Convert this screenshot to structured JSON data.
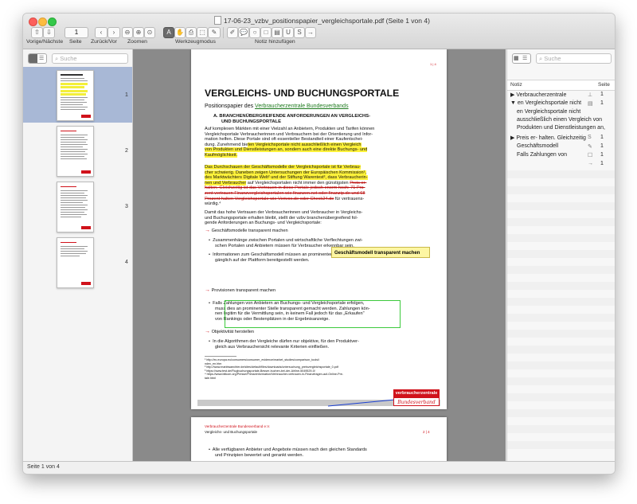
{
  "window": {
    "title": "17-06-23_vzbv_positionspapier_vergleichsportale.pdf (Seite 1 von 4)"
  },
  "toolbar": {
    "page_field_value": "1",
    "labels": {
      "prev_next": "Vorige/Nächste",
      "page": "Seite",
      "back_forward": "Zurück/Vor",
      "zoom": "Zoomen",
      "tool_mode": "Werkzeugmodus",
      "add_note": "Notiz hinzufügen"
    }
  },
  "sidebar": {
    "search_placeholder": "Suche",
    "thumbnails": [
      {
        "page_number": "1",
        "selected": true
      },
      {
        "page_number": "2",
        "selected": false
      },
      {
        "page_number": "3",
        "selected": false
      },
      {
        "page_number": "4",
        "selected": false
      }
    ]
  },
  "document": {
    "page1": {
      "page_marker": "1 | 4",
      "title": "VERGLEICHS- UND BUCHUNGSPORTALE",
      "subtitle_prefix": "Positionspapier des ",
      "subtitle_link": "Verbraucherzentrale Bundesverbands",
      "section_a_line1": "A.  BRANCHENÜBERGREIFENDE ANFORDERUNGEN AN VERGLEICHS-",
      "section_a_line2": "UND BUCHUNGSPORTALE",
      "para1": [
        "Auf komplexen Märkten mit einer Vielzahl an Anbietern, Produkten und Tarifen können",
        "Vergleichsportale Verbraucherinnen und Verbrauchern bei der Orientierung und Infor-",
        "mation helfen. Diese Portale sind oft essentieller Bestandteil einer Kaufentschei-"
      ],
      "para1_hl_lead": "dung. Zunehmend bie",
      "para1_hl": [
        "ten Vergleichsportale nicht ausschließlich einen Vergleich",
        "von Produkten und Dienstleistungen an, sondern auch eine direkte Buchungs- und",
        "Kaufmöglichkeit."
      ],
      "para2_hl": [
        "Das Durchschauen der Geschäftsmodelle der Vergleichsportale ist für Verbrau-",
        "cher schwierig. Daneben zeigen Untersuchungen der Europäischen Kommission¹,",
        "des Marktwächters Digitale Welt² und der Stiftung Warentest³, dass Verbraucherin-"
      ],
      "para2_line4_hl": "nen und Verbraucher",
      "para2_line4_rest": " auf Vergleichsportalen nicht immer den günstigsten ",
      "para2_line4_strike": "Preis er-",
      "para2_strike": [
        "halten. Gleichzeitig ist das Vertrauen in diese Portale jedoch enorm hoch: 71 Pro-",
        "zent vertrauen Finanzvergleichsportalen wie finanzen.net oder finanzip.de und 68",
        "Prozent halten Vergleichsportale wie Verivox.de oder Check24.de"
      ],
      "para2_end": " für vertrauens-",
      "para2_last": "würdig.⁴",
      "para3": [
        "Damit das hohe Vertrauen der Verbraucherinnen und Verbraucher in Vergleichs-",
        "und Buchungsportale erhalten bleibt, stellt der vzbv branchenübergreifend fol-",
        "gende Anforderungen an Buchungs- und Vergleichsportale:"
      ],
      "arrow_glyph": "→",
      "bullet_glyph": "•",
      "item1": "Geschäftsmodelle transparent machen",
      "bullet1": [
        "Zusammenhänge zwischen Portalen und wirtschaftliche Verflechtungen zwi-",
        "schen Portalen und Anbietern müssen für Verbraucher erkennbar sein."
      ],
      "bullet2": [
        "Informationen zum Geschäftsmodell müssen an prominenter Stelle leicht zu-",
        "gänglich auf der Plattform bereitgestellt werden."
      ],
      "item2": "Provisionen transparent machen",
      "bullet3": [
        "Falls Zahlungen von Anbietern an Buchungs- und Vergleichsportale erfolgen,",
        "muss dies an prominenter Stelle transparent gemacht werden. Zahlungen kön-",
        "nen legitim für die Vermittlung sein, in keinem Fall jedoch für das „Erkaufen\"",
        "von Rankings oder Bestenplätzen in der Ergebnisanzeige."
      ],
      "item3": "Objektivität herstellen",
      "bullet4": [
        "In die Algorithmen der Vergleiche dürfen nur objektive, für den Produktver-",
        "gleich aus Verbrauchersicht relevante Kriterien einfließen."
      ],
      "footnotes": [
        "¹ http://ec.europa.eu/consumers/consumer_evidence/market_studies/comparison_tools/i",
        "ndex_en.htm",
        "² http://www.marktwaechter.de/sites/default/files/downloads/untersuchung_preisvergleichsportale_0.pdf",
        "³ https://www.test.de/Flugbuchungsportale-Besser-buchen-bei-der-Airline-5049529-0/",
        "⁴ https://www.bitkom.org/Presse/Presseinformation/Verbraucher-vertrauen-in-Finanzfragen-auf-Online-Pre-",
        "tale.html"
      ],
      "brand_top": "verbraucherzentrale",
      "brand_bottom": "Bundesverband",
      "note_text": "Geschäftsmodell transparent machen"
    },
    "page2": {
      "org": "Verbraucherzentrale Bundesverband e.V.",
      "doc_title": "Vergleichs- und Buchungsportale",
      "page_marker": "2 | 4",
      "bullet_glyph": "•",
      "bullet": [
        "Alle verfügbaren Anbieter und Angebote müssen nach den gleichen Standards",
        "und Prinzipien bewertet und gerankt werden."
      ]
    }
  },
  "notes_panel": {
    "search_placeholder": "Suche",
    "col_note": "Notiz",
    "col_page": "Seite",
    "rows": [
      {
        "disclosure": "▶",
        "text": "Verbraucherzentrale",
        "icon": "⊥",
        "page": "1"
      },
      {
        "disclosure": "▼",
        "text": "en Vergleichsportale nicht",
        "icon": "▤",
        "page": "1"
      },
      {
        "disclosure": "",
        "text": "en Vergleichsportale nicht",
        "icon": "",
        "page": ""
      },
      {
        "disclosure": "",
        "text": "ausschließlich einen Vergleich von",
        "icon": "",
        "page": ""
      },
      {
        "disclosure": "",
        "text": "Produkten und Dienstleistungen an,",
        "icon": "",
        "page": ""
      },
      {
        "disclosure": "▶",
        "text": "Preis er- halten. Gleichzeitig",
        "icon": "S",
        "page": "1"
      },
      {
        "disclosure": "",
        "text": "Geschäftsmodell",
        "icon": "✎",
        "page": "1"
      },
      {
        "disclosure": "",
        "text": "Falls Zahlungen von",
        "icon": "☐",
        "page": "1"
      },
      {
        "disclosure": "",
        "text": "",
        "icon": "→",
        "page": "1"
      }
    ]
  },
  "statusbar": {
    "text": "Seite 1 von 4"
  },
  "colors": {
    "highlight": "#fff23a",
    "strike": "#b11111",
    "green_box": "#3cc93c",
    "brand_red": "#d0121b",
    "sidebar_selected": "#a8b8d6"
  }
}
